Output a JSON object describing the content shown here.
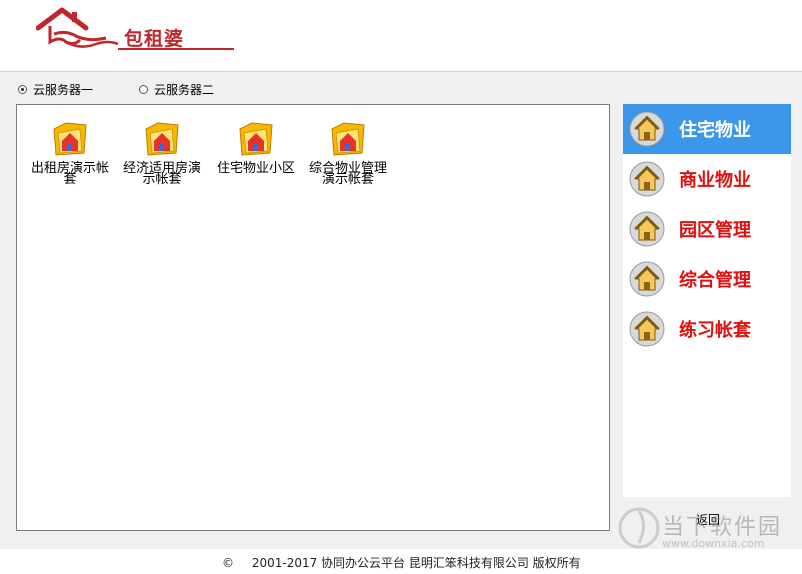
{
  "header": {
    "logo_text": "包租婆"
  },
  "servers": [
    {
      "label": "云服务器一",
      "checked": true
    },
    {
      "label": "云服务器二",
      "checked": false
    }
  ],
  "files": [
    {
      "label": "出租房演示帐套"
    },
    {
      "label": "经济适用房演示帐套"
    },
    {
      "label": "住宅物业小区"
    },
    {
      "label": "综合物业管理演示帐套"
    }
  ],
  "sidebar": {
    "items": [
      {
        "label": "住宅物业",
        "active": true
      },
      {
        "label": "商业物业",
        "active": false
      },
      {
        "label": "园区管理",
        "active": false
      },
      {
        "label": "综合管理",
        "active": false
      },
      {
        "label": "练习帐套",
        "active": false
      }
    ]
  },
  "back_label": "返回",
  "footer": {
    "copyright_symbol": "©",
    "text": "2001-2017  协同办公云平台  昆明汇笨科技有限公司  版权所有"
  },
  "watermark": {
    "text": "当下软件园",
    "url": "www.downxia.com"
  },
  "colors": {
    "accent_red": "#c0272d",
    "active_blue": "#3c96ea",
    "sidebar_text": "#e01010"
  }
}
